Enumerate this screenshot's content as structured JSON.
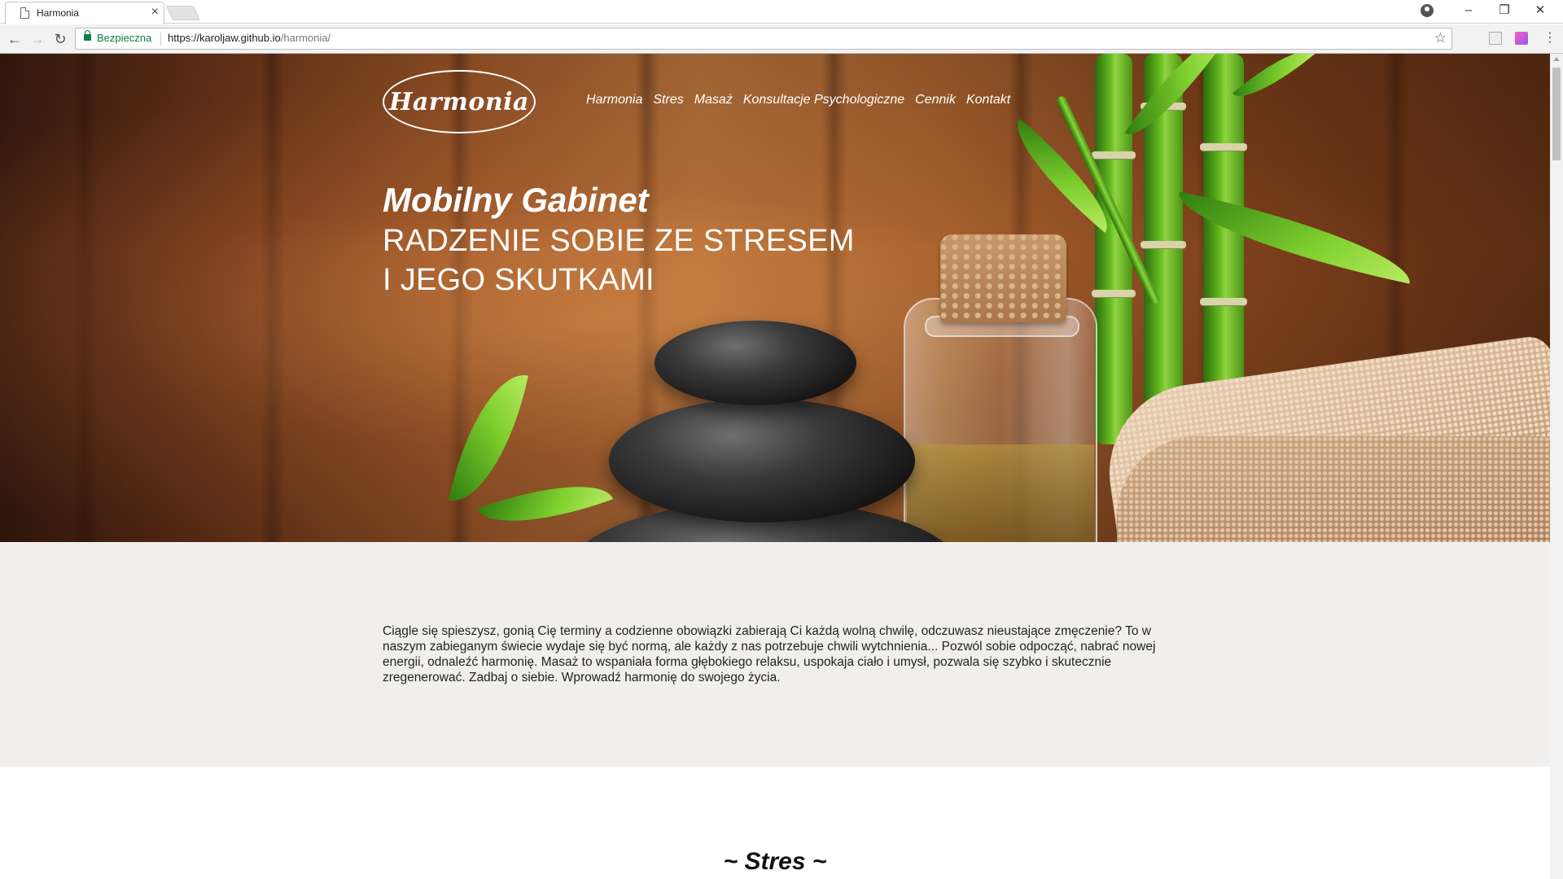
{
  "browser": {
    "tab_title": "Harmonia",
    "tab_close": "×",
    "secure_label": "Bezpieczna",
    "url_host": "https://karoljaw.github.io",
    "url_path": "/harmonia/",
    "window_controls": {
      "minimize": "–",
      "restore": "❐",
      "close": "✕"
    }
  },
  "site": {
    "logo_text": "Harmonia",
    "nav": [
      "Harmonia",
      "Stres",
      "Masaż",
      "Konsultacje Psychologiczne",
      "Cennik",
      "Kontakt"
    ],
    "hero": {
      "title": "Mobilny Gabinet",
      "subtitle_line1": "RADZENIE SOBIE ZE STRESEM",
      "subtitle_line2": "I JEGO SKUTKAMI"
    },
    "intro_text": "Ciągle się spieszysz, gonią Cię terminy a codzienne obowiązki zabierają Ci każdą wolną chwilę, odczuwasz nieustające zmęczenie? To w naszym zabieganym świecie wydaje się być normą, ale każdy z nas potrzebuje chwili wytchnienia... Pozwól sobie odpocząć, nabrać nowej energii, odnaleźć harmonię. Masaż to wspaniała forma głębokiego relaksu, uspokaja ciało i umysł, pozwala się szybko i skutecznie zregenerować. Zadbaj o siebie. Wprowadź harmonię do swojego życia.",
    "section_heading": "~ Stres ~"
  },
  "colors": {
    "secure_green": "#0b8043",
    "intro_background": "#f0efed"
  }
}
